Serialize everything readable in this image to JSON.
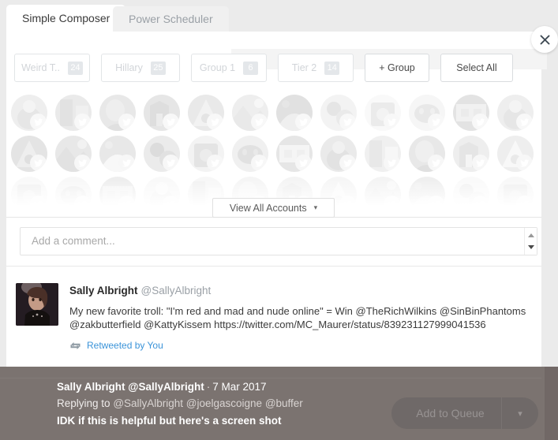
{
  "tabs": [
    {
      "label": "Simple Composer",
      "active": true
    },
    {
      "label": "Power Scheduler",
      "active": false
    }
  ],
  "close_button": {
    "icon": "close-icon",
    "label": "×"
  },
  "groups": {
    "items": [
      {
        "label": "Weird T..",
        "count": "24"
      },
      {
        "label": "Hillary",
        "count": "25"
      },
      {
        "label": "Group 1",
        "count": "6"
      },
      {
        "label": "Tier 2",
        "count": "14"
      }
    ],
    "add_group_label": "+ Group",
    "select_all_label": "Select All"
  },
  "accounts": {
    "view_all_label": "View All Accounts",
    "chevron": "▾",
    "rows": [
      [
        "#c9c9c9",
        "#bdbdbd",
        "#b4b4b4",
        "#aeaeae",
        "#c3c3c3",
        "#d2d2d2",
        "#b8b8b8",
        "#c6c6c6",
        "#dadada",
        "#d0d0d0",
        "#c0c0c0",
        "#cacaca"
      ],
      [
        "#b9b9b9",
        "#c4c4c4",
        "#d6d6d6",
        "#b0b0b0",
        "#c8c8c8",
        "#bfbfbf",
        "#cfcfcf",
        "#c2c2c2",
        "#d4d4d4",
        "#bcbcbc",
        "#cdcdcd",
        "#d8d8d8"
      ],
      [
        "#cccccc",
        "#c5c5c5",
        "#bbbbbb",
        "#dedede",
        "#d1d1d1",
        "#c7c7c7",
        "#c1c1c1",
        "#d5d5d5",
        "#c9c9c9",
        "#bebebe",
        "#d3d3d3",
        "#c4c4c4"
      ]
    ],
    "badge_icon": "twitter-icon"
  },
  "comment": {
    "placeholder": "Add a comment...",
    "value": "",
    "scroll_up_icon": "caret-up-icon",
    "scroll_down_icon": "caret-down-icon"
  },
  "tweet": {
    "author_name": "Sally Albright",
    "author_handle": "@SallyAlbright",
    "body": "My new favorite troll: \"I'm red and mad and nude online\" = Win @TheRichWilkins @SinBinPhantoms @zakbutterfield @KattyKissem https://twitter.com/MC_Maurer/status/839231127999041536",
    "retweet_label": "Retweeted by You",
    "retweet_icon": "retweet-icon",
    "avatar_icon": "user-avatar"
  },
  "overlay": {
    "author_name": "Sally Albright",
    "author_handle": "@SallyAlbright",
    "separator": "·",
    "date": "7 Mar 2017",
    "replying_prefix": "Replying to",
    "replying_handles": "@SallyAlbright @joelgascoigne @buffer",
    "message": "IDK if this is helpful but here's a screen shot",
    "queue_button_label": "Add to Queue",
    "queue_chevron": "▾"
  },
  "colors": {
    "accent_link": "#3b94d9",
    "overlay_bg": "#7b7370",
    "badge_bg": "#ced4d9",
    "panel_bg": "#ffffff",
    "page_bg": "#ebebeb"
  }
}
